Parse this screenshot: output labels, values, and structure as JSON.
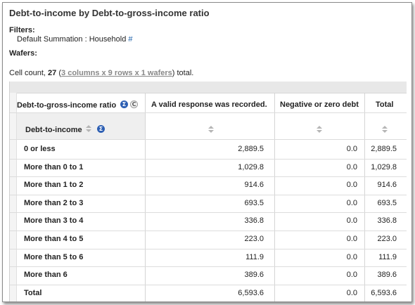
{
  "title": "Debt-to-income by Debt-to-gross-income ratio",
  "filters": {
    "label": "Filters:",
    "item": "Default Summation : Household",
    "hash": "#"
  },
  "wafers": {
    "label": "Wafers:"
  },
  "cellcount": {
    "prefix": "Cell count,",
    "count": "27",
    "open": "(",
    "link": "3 columns x 9 rows x 1 wafers",
    "suffix": ") total."
  },
  "table": {
    "row_dim_header": "Debt-to-gross-income ratio",
    "sub_header": "Debt-to-income",
    "sigma": "Σ",
    "c": "C",
    "columns": [
      "A valid response was recorded.",
      "Negative or zero debt",
      "Total"
    ],
    "rows": [
      {
        "label": "0 or less",
        "values": [
          "2,889.5",
          "0.0",
          "2,889.5"
        ]
      },
      {
        "label": "More than 0 to 1",
        "values": [
          "1,029.8",
          "0.0",
          "1,029.8"
        ]
      },
      {
        "label": "More than 1 to 2",
        "values": [
          "914.6",
          "0.0",
          "914.6"
        ]
      },
      {
        "label": "More than 2 to 3",
        "values": [
          "693.5",
          "0.0",
          "693.5"
        ]
      },
      {
        "label": "More than 3 to 4",
        "values": [
          "336.8",
          "0.0",
          "336.8"
        ]
      },
      {
        "label": "More than 4 to 5",
        "values": [
          "223.0",
          "0.0",
          "223.0"
        ]
      },
      {
        "label": "More than 5 to 6",
        "values": [
          "111.9",
          "0.0",
          "111.9"
        ]
      },
      {
        "label": "More than 6",
        "values": [
          "389.6",
          "0.0",
          "389.6"
        ]
      },
      {
        "label": "Total",
        "values": [
          "6,593.6",
          "0.0",
          "6,593.6"
        ]
      }
    ]
  },
  "colors": {
    "link": "#1a5fa8",
    "sigma": "#2d5fb3"
  }
}
